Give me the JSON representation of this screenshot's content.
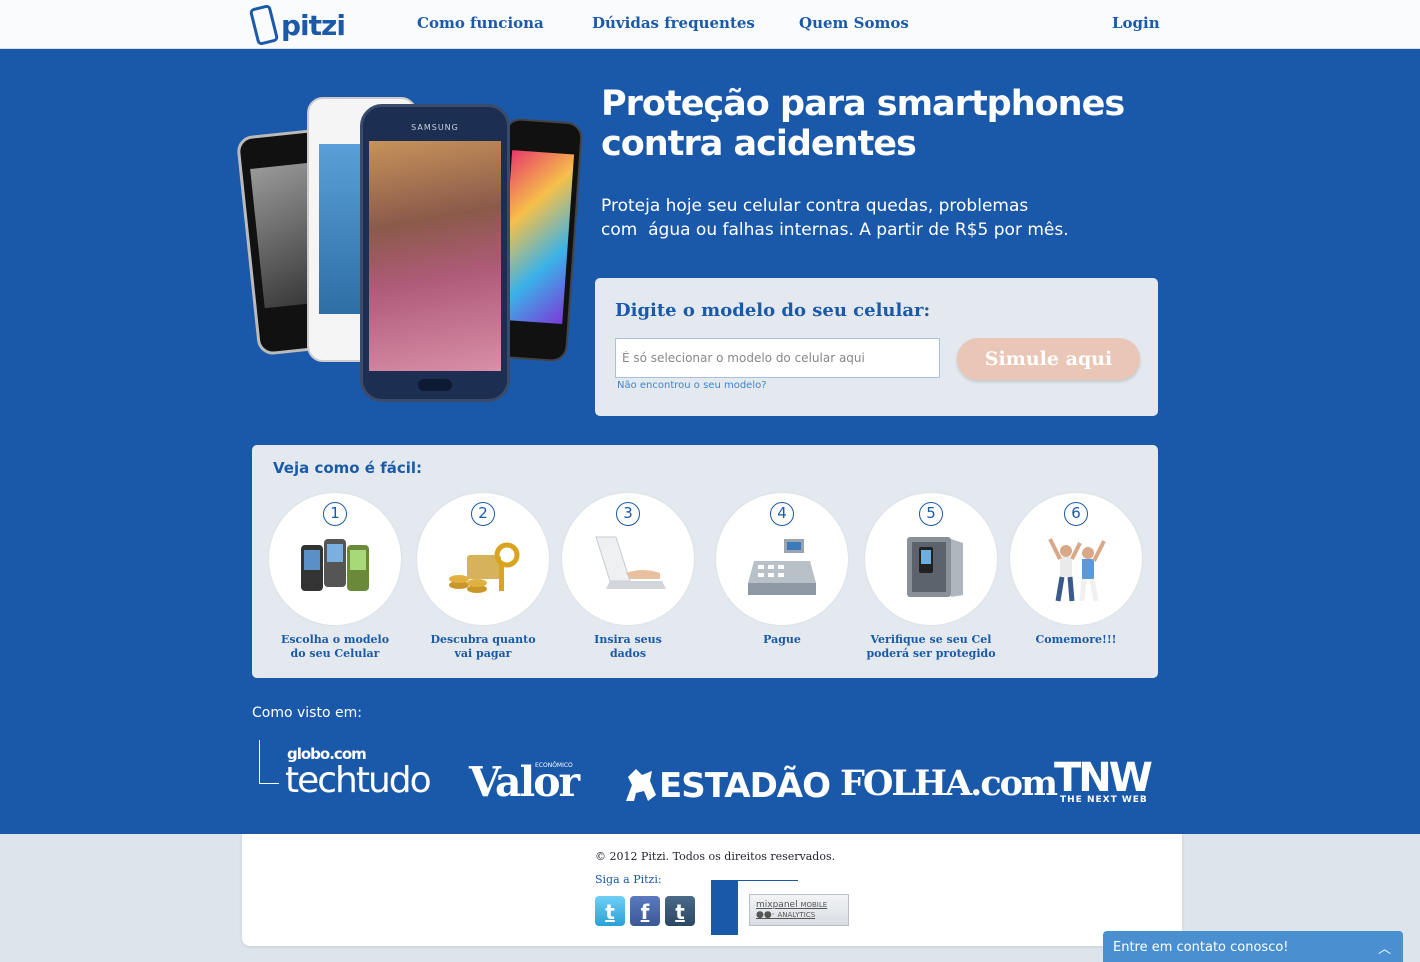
{
  "header": {
    "logo_text": "pitzi",
    "nav": [
      "Como funciona",
      "Dúvidas frequentes",
      "Quem Somos"
    ],
    "login": "Login"
  },
  "hero": {
    "phone_brand": "SAMSUNG",
    "headline_line1": "Proteção para smartphones",
    "headline_line2": "contra acidentes",
    "sub_line1": "Proteja hoje seu celular contra quedas, problemas",
    "sub_line2": "com  água ou falhas internas. A partir de R$5 por mês."
  },
  "simulator": {
    "title": "Digite o modelo do seu celular:",
    "placeholder": "É só selecionar o modelo do celular aqui",
    "not_found_link": "Não encontrou o seu modelo?",
    "button": "Simule aqui"
  },
  "steps": {
    "title": "Veja como é fácil:",
    "items": [
      {
        "num": "1",
        "line1": "Escolha o modelo",
        "line2": "do seu Celular",
        "icon": "phones-icon"
      },
      {
        "num": "2",
        "line1": "Descubra quanto",
        "line2": "vai pagar",
        "icon": "coins-key-icon"
      },
      {
        "num": "3",
        "line1": "Insira seus",
        "line2": "dados",
        "icon": "laptop-typing-icon"
      },
      {
        "num": "4",
        "line1": "Pague",
        "line2": "",
        "icon": "cash-register-icon"
      },
      {
        "num": "5",
        "line1": "Verifique se seu Cel",
        "line2": "poderá ser protegido",
        "icon": "safe-icon"
      },
      {
        "num": "6",
        "line1": "Comemore!!!",
        "line2": "",
        "icon": "celebrating-couple-icon"
      }
    ]
  },
  "press": {
    "title": "Como visto em:",
    "globo_small": "globo.com",
    "techtudo": "techtudo",
    "valor": "Valor",
    "valor_small": "ECONÔMICO",
    "estadao": "ESTADÃO",
    "folha": "FOLHA.com",
    "tnw": "TNW",
    "tnw_small": "THE NEXT WEB"
  },
  "footer": {
    "copyright": "© 2012 Pitzi. Todos os direitos reservados.",
    "follow": "Siga a Pitzi:",
    "social": [
      "twitter-icon",
      "facebook-icon",
      "tumblr-icon"
    ],
    "mixpanel_name": "mixpanel",
    "mixpanel_tag1": "MOBILE",
    "mixpanel_tag2": "ANALYTICS"
  },
  "contact_widget": {
    "label": "Entre em contato conosco!"
  },
  "colors": {
    "brand_blue": "#1a59aa",
    "panel_gray": "#e4e9ef",
    "cta_peach": "#e9c6b5",
    "contact_blue": "#4a8fd0"
  }
}
